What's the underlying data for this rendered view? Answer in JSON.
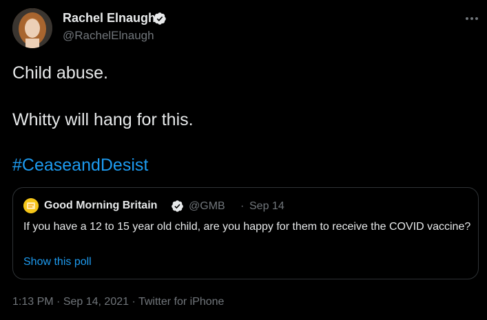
{
  "author": {
    "name": "Rachel Elnaugh",
    "handle": "@RachelElnaugh"
  },
  "tweet": {
    "line1": "Child abuse.",
    "line2": "Whitty will hang for this.",
    "hashtag": "#CeaseandDesist"
  },
  "quoted": {
    "name": "Good Morning Britain",
    "handle": "@GMB",
    "separator": "·",
    "date": "Sep 14",
    "text": "If you have a 12 to 15 year old child, are you happy for them to receive the COVID vaccine?",
    "poll_link": "Show this poll"
  },
  "meta": {
    "time": "1:13 PM",
    "sep1": " · ",
    "date": "Sep 14, 2021",
    "sep2": " · ",
    "source": "Twitter for iPhone"
  },
  "colors": {
    "background": "#000000",
    "accent": "#1d9bf0",
    "muted": "#71767b",
    "verified": "#e7e9ea",
    "gmb_logo": "#f5c518"
  },
  "icons": {
    "verified": "verified-badge-icon",
    "more": "more-dots-icon"
  }
}
